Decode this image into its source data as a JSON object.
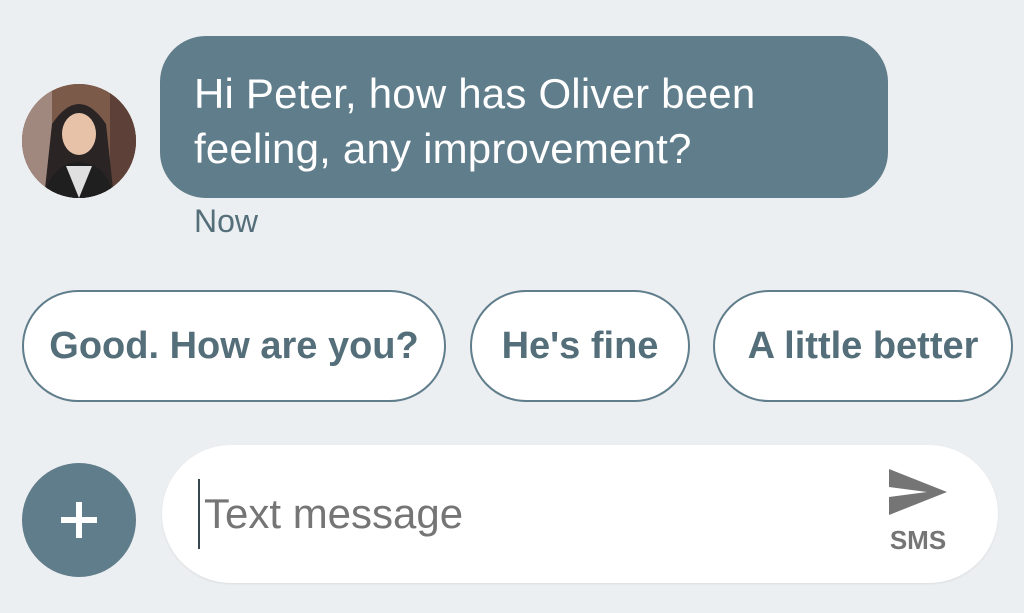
{
  "message": {
    "text": "Hi Peter, how has Oliver been feeling, any improvement?",
    "line1": "Hi Peter, how has Oliver been",
    "line2": "feeling, any improvement?",
    "timestamp": "Now",
    "bubble_color": "#607d8b"
  },
  "smart_replies": [
    {
      "label": "Good. How are you?"
    },
    {
      "label": "He's fine"
    },
    {
      "label": "A little better"
    }
  ],
  "compose": {
    "placeholder": "Text message",
    "send_label": "SMS",
    "add_icon": "plus-icon",
    "send_icon": "send-icon"
  },
  "colors": {
    "background": "#eceff1",
    "accent": "#607d8b",
    "chip_text": "#546e7a"
  }
}
